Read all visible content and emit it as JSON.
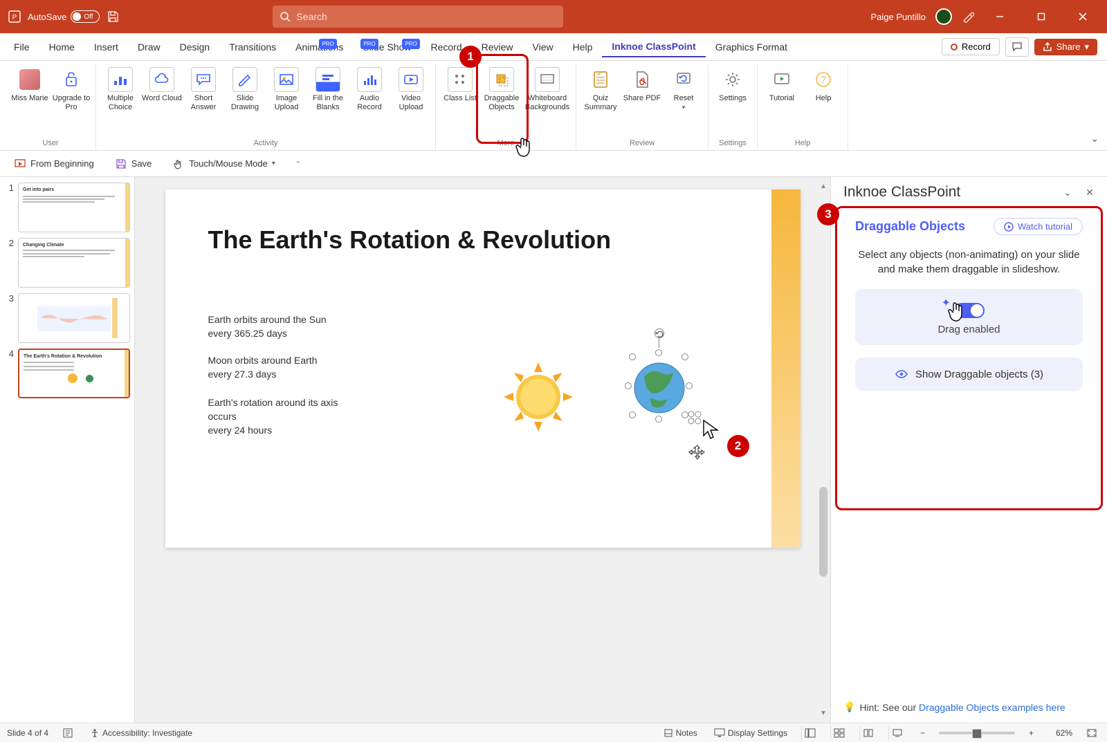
{
  "titlebar": {
    "autosave_label": "AutoSave",
    "autosave_state": "Off",
    "search_placeholder": "Search",
    "user_name": "Paige Puntillo"
  },
  "menubar": {
    "items": [
      "File",
      "Home",
      "Insert",
      "Draw",
      "Design",
      "Transitions",
      "Animations",
      "Slide Show",
      "Record",
      "Review",
      "View",
      "Help",
      "Inknoe ClassPoint",
      "Graphics Format"
    ],
    "record_label": "Record",
    "share_label": "Share"
  },
  "ribbon": {
    "groups": [
      {
        "label": "User",
        "buttons": [
          {
            "name": "miss-marie",
            "label": "Miss Marie"
          },
          {
            "name": "upgrade-pro",
            "label": "Upgrade to Pro"
          }
        ]
      },
      {
        "label": "Activity",
        "buttons": [
          {
            "name": "multiple-choice",
            "label": "Multiple Choice"
          },
          {
            "name": "word-cloud",
            "label": "Word Cloud"
          },
          {
            "name": "short-answer",
            "label": "Short Answer"
          },
          {
            "name": "slide-drawing",
            "label": "Slide Drawing"
          },
          {
            "name": "image-upload",
            "label": "Image Upload"
          },
          {
            "name": "fill-blanks",
            "label": "Fill in the Blanks",
            "pro": true
          },
          {
            "name": "audio-record",
            "label": "Audio Record",
            "pro": true
          },
          {
            "name": "video-upload",
            "label": "Video Upload",
            "pro": true
          }
        ]
      },
      {
        "label": "More",
        "buttons": [
          {
            "name": "class-list",
            "label": "Class List"
          },
          {
            "name": "draggable-objects",
            "label": "Draggable Objects"
          },
          {
            "name": "whiteboard-backgrounds",
            "label": "Whiteboard Backgrounds"
          }
        ]
      },
      {
        "label": "Review",
        "buttons": [
          {
            "name": "quiz-summary",
            "label": "Quiz Summary"
          },
          {
            "name": "share-pdf",
            "label": "Share PDF"
          },
          {
            "name": "reset",
            "label": "Reset"
          }
        ]
      },
      {
        "label": "Settings",
        "buttons": [
          {
            "name": "settings",
            "label": "Settings"
          }
        ]
      },
      {
        "label": "Help",
        "buttons": [
          {
            "name": "tutorial",
            "label": "Tutorial"
          },
          {
            "name": "help",
            "label": "Help"
          }
        ]
      }
    ]
  },
  "qat": {
    "from_beginning": "From Beginning",
    "save": "Save",
    "touch_mouse": "Touch/Mouse Mode"
  },
  "thumbs": {
    "t1_title": "Get into pairs",
    "t2_title": "Changing Climate",
    "t4_title": "The Earth's Rotation & Revolution"
  },
  "slide": {
    "title": "The Earth's Rotation & Revolution",
    "p1": "Earth orbits around the Sun every 365.25 days",
    "p2": "Moon orbits around Earth every 27.3 days",
    "p3": "Earth's rotation around its axis occurs every 24 hours"
  },
  "panel": {
    "header": "Inknoe ClassPoint",
    "title": "Draggable Objects",
    "watch": "Watch tutorial",
    "desc": "Select any objects (non-animating) on your slide and make them draggable in slideshow.",
    "drag_label": "Drag enabled",
    "show_label": "Show Draggable objects (3)",
    "hint_prefix": "Hint: See our ",
    "hint_link": "Draggable Objects examples here"
  },
  "status": {
    "slide_count": "Slide 4 of 4",
    "accessibility": "Accessibility: Investigate",
    "notes": "Notes",
    "display_settings": "Display Settings",
    "zoom": "62%"
  },
  "callouts": {
    "c1": "1",
    "c2": "2",
    "c3": "3"
  }
}
